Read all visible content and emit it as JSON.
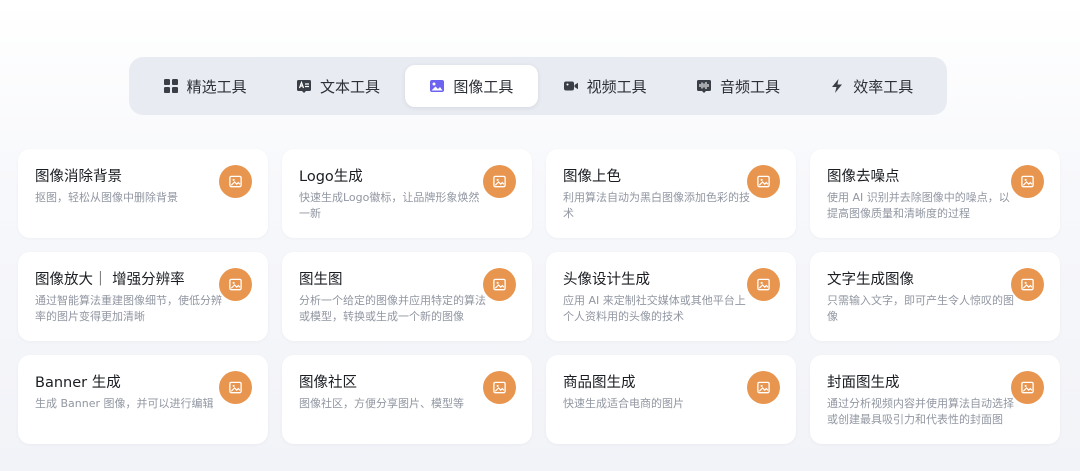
{
  "tabs": [
    {
      "label": "精选工具",
      "icon": "grid-icon",
      "active": false
    },
    {
      "label": "文本工具",
      "icon": "text-icon",
      "active": false
    },
    {
      "label": "图像工具",
      "icon": "image-icon",
      "active": true
    },
    {
      "label": "视频工具",
      "icon": "video-icon",
      "active": false
    },
    {
      "label": "音频工具",
      "icon": "audio-icon",
      "active": false
    },
    {
      "label": "效率工具",
      "icon": "lightning-icon",
      "active": false
    }
  ],
  "accent_color": "#e8964f",
  "active_tab_icon_color": "#6c63f0",
  "cards": [
    {
      "title": "图像消除背景",
      "desc": "抠图，轻松从图像中删除背景",
      "icon": "image-icon"
    },
    {
      "title": "Logo生成",
      "desc": "快速生成Logo徽标，让品牌形象焕然一新",
      "icon": "image-icon"
    },
    {
      "title": "图像上色",
      "desc": "利用算法自动为黑白图像添加色彩的技术",
      "icon": "image-icon"
    },
    {
      "title": "图像去噪点",
      "desc": "使用 AI 识别并去除图像中的噪点，以提高图像质量和清晰度的过程",
      "icon": "image-icon"
    },
    {
      "title": "图像放大｜ 增强分辨率",
      "desc": "通过智能算法重建图像细节，使低分辨率的图片变得更加清晰",
      "icon": "image-icon"
    },
    {
      "title": "图生图",
      "desc": "分析一个给定的图像并应用特定的算法或模型，转换或生成一个新的图像",
      "icon": "image-icon"
    },
    {
      "title": "头像设计生成",
      "desc": "应用 AI 来定制社交媒体或其他平台上个人资料用的头像的技术",
      "icon": "image-icon"
    },
    {
      "title": "文字生成图像",
      "desc": "只需输入文字，即可产生令人惊叹的图像",
      "icon": "image-icon"
    },
    {
      "title": "Banner 生成",
      "desc": "生成 Banner 图像，并可以进行编辑",
      "icon": "image-icon"
    },
    {
      "title": "图像社区",
      "desc": "图像社区，方便分享图片、模型等",
      "icon": "image-icon"
    },
    {
      "title": "商品图生成",
      "desc": "快速生成适合电商的图片",
      "icon": "image-icon"
    },
    {
      "title": "封面图生成",
      "desc": "通过分析视频内容并使用算法自动选择或创建最具吸引力和代表性的封面图",
      "icon": "image-icon"
    }
  ]
}
